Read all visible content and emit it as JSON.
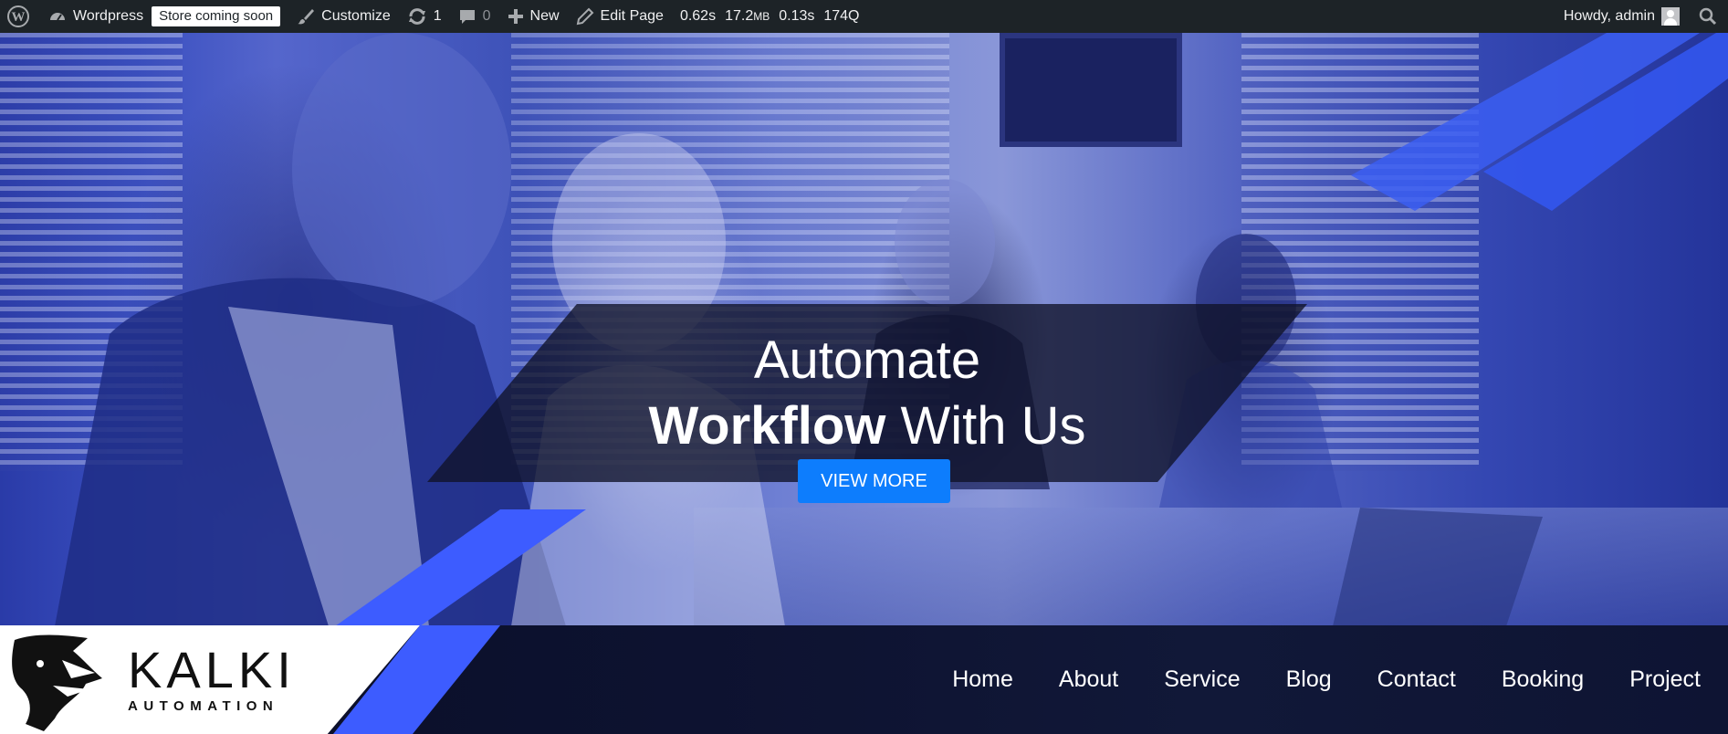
{
  "adminbar": {
    "site_name": "Wordpress",
    "store_badge": "Store coming soon",
    "customize": "Customize",
    "updates_count": "1",
    "comments_count": "0",
    "new_label": "New",
    "edit_page": "Edit Page",
    "query_monitor": {
      "time": "0.62s",
      "memory": "17.2",
      "memory_unit": "MB",
      "db_time": "0.13s",
      "queries": "174Q"
    },
    "greeting": "Howdy, admin"
  },
  "hero": {
    "line1": "Automate",
    "line2_bold": "Workflow",
    "line2_rest": " With Us",
    "button_label": "VIEW MORE"
  },
  "logo": {
    "title": "KALKI",
    "subtitle": "AUTOMATION"
  },
  "nav": {
    "items": [
      "Home",
      "About",
      "Service",
      "Blog",
      "Contact",
      "Booking",
      "Project"
    ]
  },
  "colors": {
    "adminbar_bg": "#1d2327",
    "accent_blue": "#3d5cff",
    "button_blue": "#0d7dfd",
    "header_bg": "#0d1230"
  }
}
